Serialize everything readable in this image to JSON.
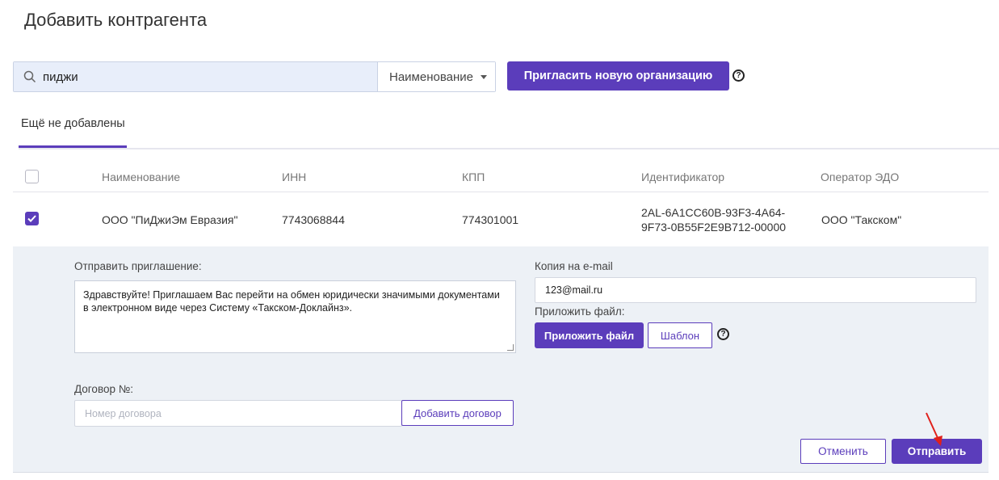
{
  "page": {
    "title": "Добавить контрагента"
  },
  "search": {
    "value": "пиджи",
    "filter_selected": "Наименование",
    "invite_label": "Пригласить новую организацию"
  },
  "tabs": [
    {
      "label": "Ещё не добавлены",
      "active": true
    }
  ],
  "table": {
    "headers": [
      "Наименование",
      "ИНН",
      "КПП",
      "Идентификатор",
      "Оператор ЭДО"
    ],
    "rows": [
      {
        "checked": true,
        "name": "ООО \"ПиДжиЭм Евразия\"",
        "inn": "7743068844",
        "kpp": "774301001",
        "id_line1": "2AL-6A1CC60B-93F3-4A64-",
        "id_line2": "9F73-0B55F2E9B712-00000",
        "operator": "ООО \"Такском\""
      }
    ]
  },
  "invite_form": {
    "message_label": "Отправить приглашение:",
    "message_text": "Здравствуйте! Приглашаем Вас перейти на обмен юридически значимыми документами в электронном виде через Систему «Такском-Доклайнз».",
    "copy_email_label": "Копия на e-mail",
    "copy_email_value": "123@mail.ru",
    "attach_label": "Приложить файл:",
    "attach_button": "Приложить файл",
    "template_button": "Шаблон",
    "contract_label": "Договор №:",
    "contract_placeholder": "Номер договора",
    "add_contract_button": "Добавить договор",
    "cancel_button": "Отменить",
    "send_button": "Отправить"
  },
  "colors": {
    "accent": "#5b3dbb",
    "panel_bg": "#edf1f6",
    "search_bg": "#e8eefa",
    "annotation_arrow": "#e0201b"
  },
  "icons": [
    "search-icon",
    "chevron-down-icon",
    "help-icon",
    "checkmark-icon",
    "resize-grip-icon",
    "red-arrow-annotation"
  ]
}
